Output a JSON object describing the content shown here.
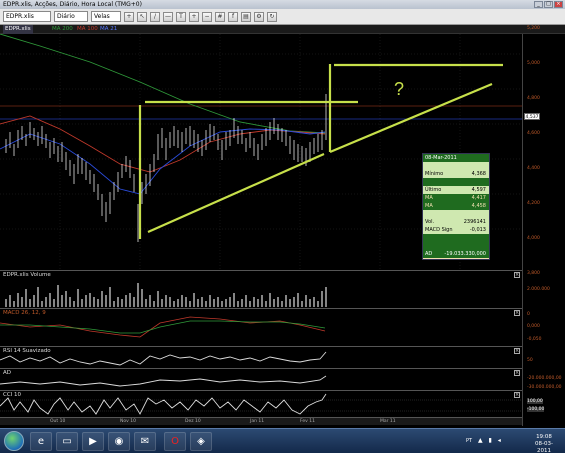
{
  "window": {
    "title": "EDPR.xlis, Acções, Diário, Hora Local (TMG+0)"
  },
  "toolbar": {
    "symbol": "EDPR.xlis",
    "period": "Diário",
    "chart_type": "Velas"
  },
  "tabs": {
    "symbol_tab": "EDPR.xlis",
    "ma200": "MA 200",
    "ma100": "MA 100",
    "ma21": "MA 21"
  },
  "price_axis": {
    "labels": [
      "5,200",
      "5,000",
      "4,800",
      "4,600",
      "4,400",
      "4,200",
      "4,000",
      "3,800"
    ],
    "current_price": "4,537"
  },
  "annotation": {
    "question": "?"
  },
  "info_box": {
    "date": "08-Mar-2011",
    "rows": [
      {
        "label": "",
        "value": ""
      },
      {
        "label": "Mínimo",
        "value": "4,368"
      },
      {
        "label": "",
        "value": ""
      },
      {
        "label": "Último",
        "value": "4,597"
      },
      {
        "label": "MA",
        "value": "4,417"
      },
      {
        "label": "MA",
        "value": "4,458"
      },
      {
        "label": "",
        "value": ""
      },
      {
        "label": "Vol.",
        "value": "2396141"
      },
      {
        "label": "MACD Sign",
        "value": "-0,013"
      },
      {
        "label": "",
        "value": ""
      },
      {
        "label": "",
        "value": ""
      },
      {
        "label": "AD",
        "value": "-19.033.330,000"
      }
    ]
  },
  "subcharts": {
    "volume": {
      "label": "EDPR.xlis Volume",
      "axis": [
        "2.000.000",
        "0"
      ]
    },
    "macd": {
      "label": "MACD 26, 12, 9",
      "axis": [
        "0,000",
        "-0,050"
      ]
    },
    "rsi": {
      "label": "RSI 14 Suavizado",
      "axis": [
        "50"
      ]
    },
    "ad": {
      "label": "AD",
      "axis": [
        "-20.000.000,00",
        "-30.000.000,00"
      ]
    },
    "cci": {
      "label": "CCI 10",
      "axis": [
        "100,00",
        "-100,00"
      ]
    }
  },
  "x_axis": {
    "labels": [
      "Out 10",
      "Nov 10",
      "Dez 10",
      "Jan 11",
      "Fev 11",
      "Mar 11"
    ]
  },
  "taskbar": {
    "lang": "PT",
    "time": "19:08",
    "date": "08-03-2011"
  },
  "colors": {
    "background": "#000000",
    "trendline": "#c7e04a",
    "ma200": "#2f9a3a",
    "ma100": "#c0392b",
    "ma21": "#2a4bd8",
    "candle": "#ffffff"
  },
  "chart_data": {
    "type": "line",
    "title": "",
    "series": [
      {
        "name": "MA 200",
        "values": []
      },
      {
        "name": "MA 100",
        "values": []
      },
      {
        "name": "MA 21",
        "values": []
      }
    ],
    "x": [
      "Out 10",
      "Nov 10",
      "Dez 10",
      "Jan 11",
      "Fev 11",
      "Mar 11"
    ],
    "ylim": [
      3.8,
      5.2
    ]
  }
}
